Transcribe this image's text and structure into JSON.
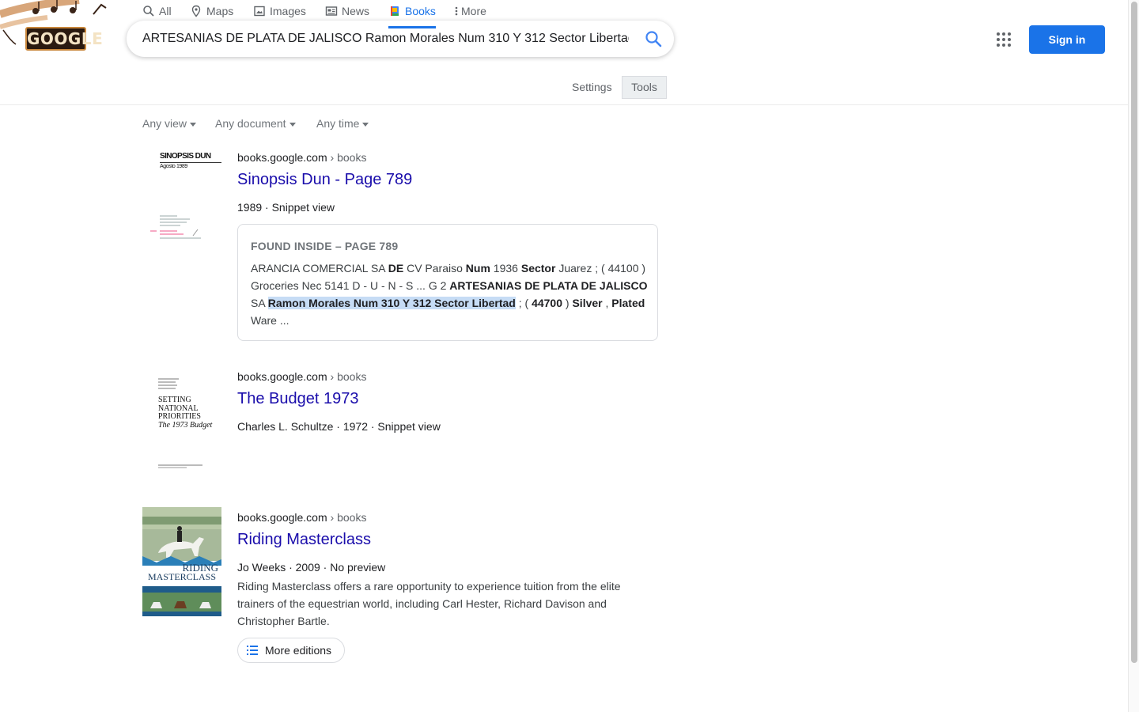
{
  "header": {
    "logo_text": "GOOGLE",
    "search_query": "ARTESANIAS DE PLATA DE JALISCO Ramon Morales Num 310 Y 312 Sector Libertad",
    "sign_in": "Sign in"
  },
  "tabs": {
    "all": "All",
    "maps": "Maps",
    "images": "Images",
    "news": "News",
    "books": "Books",
    "more": "More",
    "settings": "Settings",
    "tools": "Tools",
    "active": "Books",
    "accent_color": "#1a73e8"
  },
  "filters": {
    "view": "Any view",
    "document": "Any document",
    "time": "Any time"
  },
  "results": [
    {
      "site": "books.google.com",
      "path": "› books",
      "title": "Sinopsis Dun - Page 789",
      "meta": "1989 · Snippet view",
      "cover_title": "SINOPSIS DUN",
      "cover_subtitle": "Agosto 1989",
      "found_label": "FOUND INSIDE – PAGE 789",
      "snippet": {
        "s1": "ARANCIA COMERCIAL SA ",
        "b1": "DE",
        "s2": " CV Paraiso ",
        "b2": "Num",
        "s3": " 1936 ",
        "b3": "Sector",
        "s4": " Juarez ; ( 44100 ) Groceries Nec 5141 D - U - N - S ... G 2 ",
        "b4": "ARTESANIAS DE PLATA DE JALISCO",
        "s5": " SA ",
        "hl": "Ramon Morales Num 310 Y 312 Sector Libertad",
        "s6": " ; ( ",
        "b5": "44700",
        "s7": " ) ",
        "b6": "Silver",
        "s8": " , ",
        "b7": "Plated",
        "s9": " Ware ..."
      }
    },
    {
      "site": "books.google.com",
      "path": "› books",
      "title": "The Budget 1973",
      "meta": "Charles L. Schultze · 1972 · Snippet view",
      "cover_lines": [
        "SETTING",
        "NATIONAL",
        "PRIORITIES",
        "The 1973 Budget"
      ]
    },
    {
      "site": "books.google.com",
      "path": "› books",
      "title": "Riding Masterclass",
      "meta": "Jo Weeks · 2009 · No preview",
      "description": "Riding Masterclass offers a rare opportunity to experience tuition from the elite trainers of the equestrian world, including Carl Hester, Richard Davison and Christopher Bartle.",
      "cover_title_1": "RIDING",
      "cover_title_2": "MASTERCLASS",
      "more_editions": "More editions"
    }
  ],
  "icons": [
    "search-icon",
    "apps-grid-icon",
    "map-pin-icon",
    "image-icon",
    "news-icon",
    "book-icon",
    "more-dots-icon",
    "list-icon"
  ]
}
